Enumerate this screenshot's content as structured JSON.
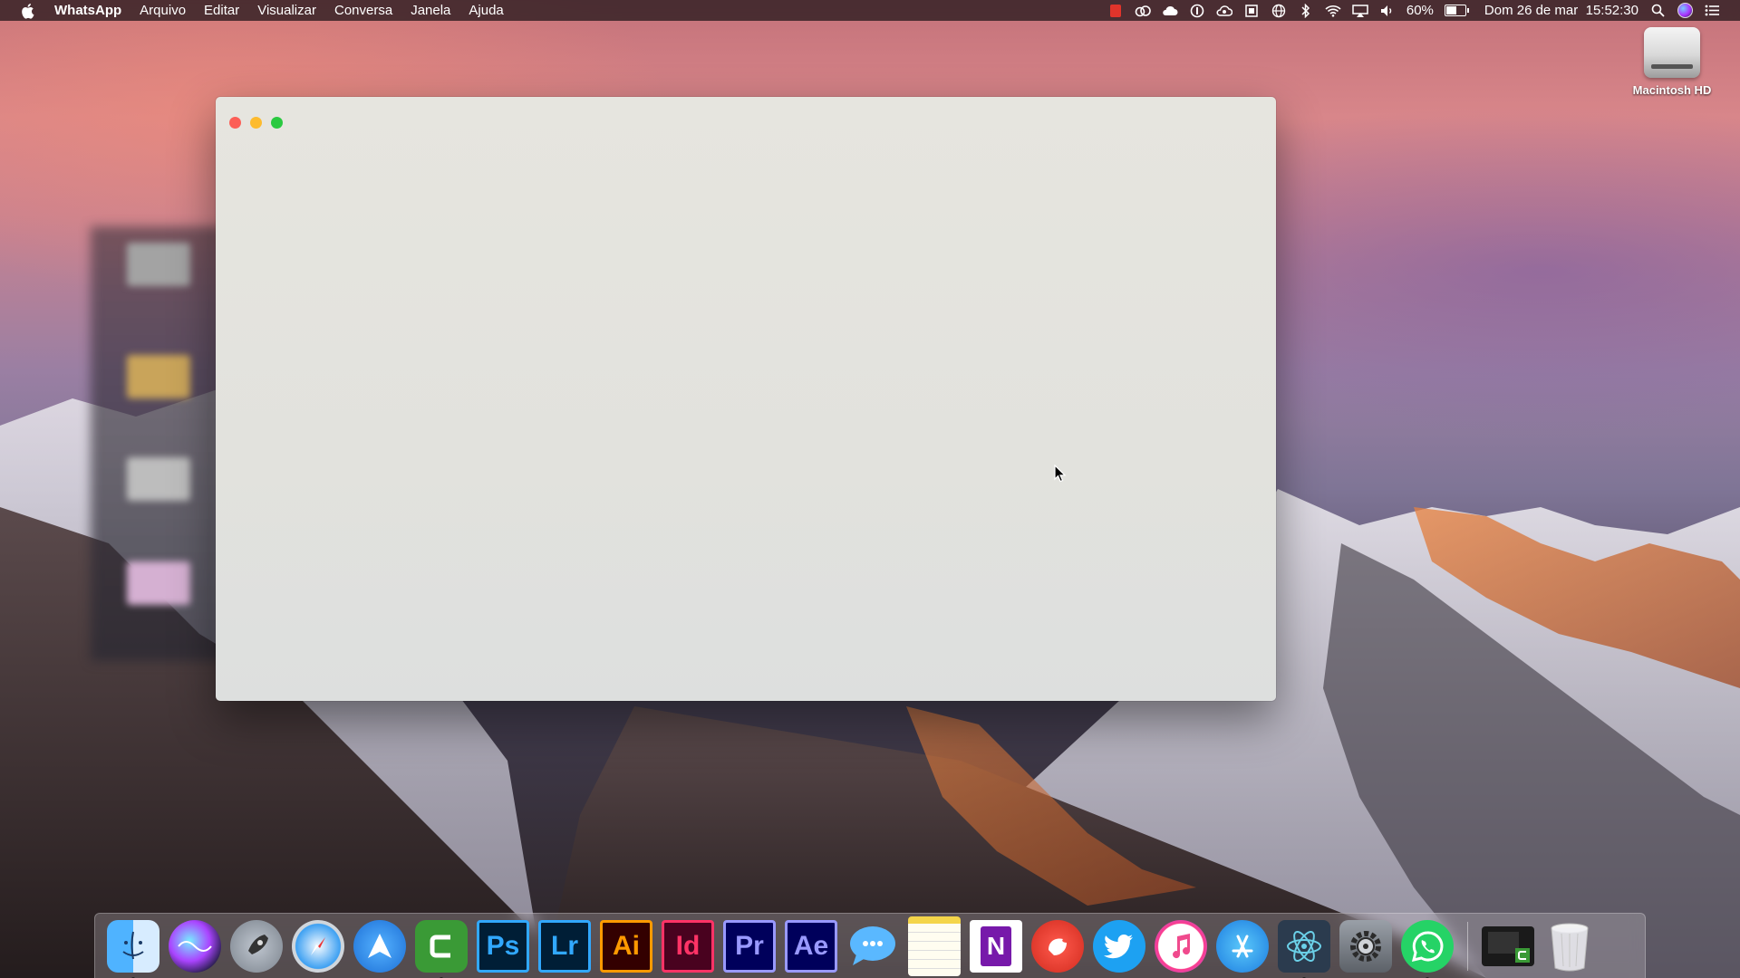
{
  "menubar": {
    "app_name": "WhatsApp",
    "menus": [
      "Arquivo",
      "Editar",
      "Visualizar",
      "Conversa",
      "Janela",
      "Ajuda"
    ],
    "battery_percent": "60%",
    "battery_level": 0.6,
    "datetime": "Dom 26 de mar  15:52:30",
    "status_icons": [
      "recording-icon",
      "creative-cloud-icon",
      "cloud-icon",
      "onepassword-icon",
      "cloud-sync-icon",
      "app-status-icon",
      "globe-icon",
      "bluetooth-icon",
      "wifi-icon",
      "airplay-icon",
      "volume-icon",
      "battery-icon",
      "spotlight-icon",
      "siri-icon",
      "notification-center-icon"
    ]
  },
  "desktop": {
    "drive_label": "Macintosh HD"
  },
  "window": {
    "title": ""
  },
  "dock": {
    "items": [
      {
        "name": "finder",
        "label": ""
      },
      {
        "name": "siri",
        "label": ""
      },
      {
        "name": "launchpad",
        "label": ""
      },
      {
        "name": "safari",
        "label": ""
      },
      {
        "name": "spark",
        "label": ""
      },
      {
        "name": "camtasia",
        "label": ""
      },
      {
        "name": "photoshop",
        "label": "Ps"
      },
      {
        "name": "lightroom",
        "label": "Lr"
      },
      {
        "name": "illustrator",
        "label": "Ai"
      },
      {
        "name": "indesign",
        "label": "Id"
      },
      {
        "name": "premiere",
        "label": "Pr"
      },
      {
        "name": "after-effects",
        "label": "Ae"
      },
      {
        "name": "messages",
        "label": ""
      },
      {
        "name": "notes",
        "label": ""
      },
      {
        "name": "onenote",
        "label": "N"
      },
      {
        "name": "pocket-app",
        "label": ""
      },
      {
        "name": "twitter",
        "label": ""
      },
      {
        "name": "itunes",
        "label": ""
      },
      {
        "name": "app-store",
        "label": ""
      },
      {
        "name": "atom",
        "label": ""
      },
      {
        "name": "system-preferences",
        "label": ""
      },
      {
        "name": "whatsapp",
        "label": ""
      },
      {
        "name": "camtasia-recorder",
        "label": ""
      },
      {
        "name": "trash",
        "label": ""
      }
    ]
  },
  "colors": {
    "close": "#fc5f57",
    "minimize": "#fdbb2e",
    "maximize": "#2ac940",
    "photoshop": "#31a8ff",
    "lightroom": "#31a8ff",
    "illustrator": "#ff9a00",
    "indesign": "#ff3366",
    "premiere": "#9999ff",
    "after_effects": "#9999ff"
  }
}
